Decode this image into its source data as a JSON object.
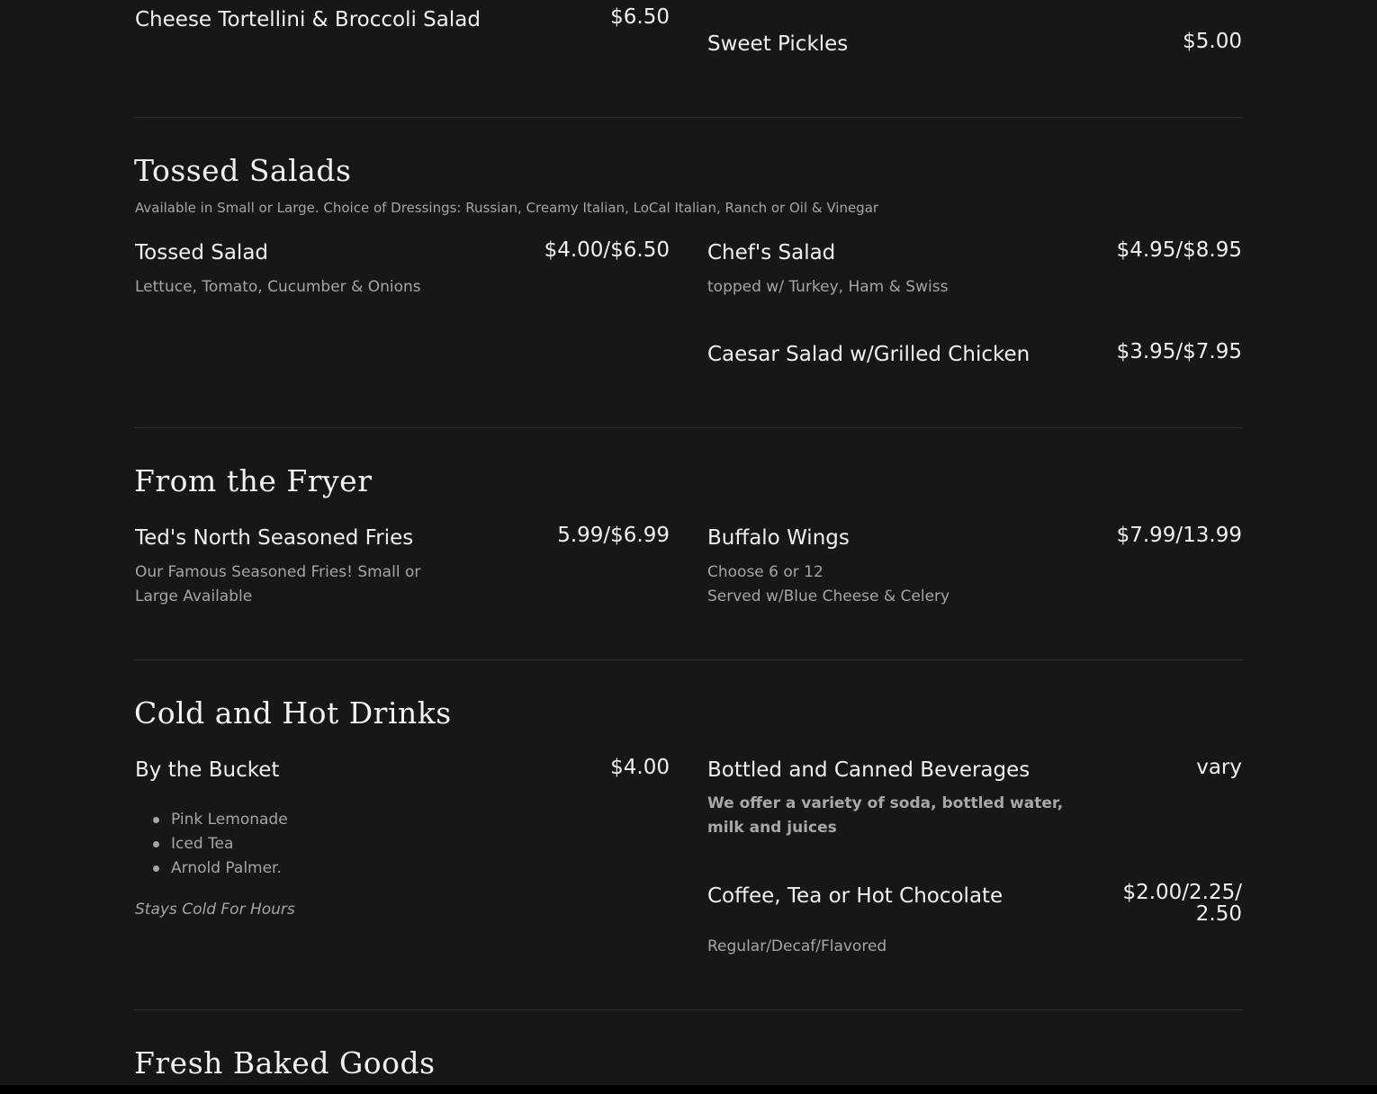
{
  "top_items": {
    "left": {
      "name": "Cheese Tortellini & Broccoli Salad",
      "price": "$6.50"
    },
    "right": {
      "name": "Sweet Pickles",
      "price": "$5.00"
    }
  },
  "tossed_salads": {
    "title": "Tossed Salads",
    "note": "Available in Small or Large. Choice of Dressings: Russian, Creamy Italian, LoCal Italian, Ranch or Oil & Vinegar",
    "items": [
      {
        "name": "Tossed Salad",
        "price": "$4.00/$6.50",
        "desc": "Lettuce, Tomato, Cucumber & Onions"
      },
      {
        "name": "Chef's Salad",
        "price": "$4.95/$8.95",
        "desc": "topped w/ Turkey, Ham & Swiss"
      },
      {
        "name": "Caesar Salad w/Grilled Chicken",
        "price": "$3.95/$7.95"
      }
    ]
  },
  "fryer": {
    "title": "From the Fryer",
    "items": [
      {
        "name": "Ted's North Seasoned Fries",
        "price": "5.99/$6.99",
        "desc_line1": "Our Famous Seasoned Fries! Small or",
        "desc_line2": "Large Available"
      },
      {
        "name": "Buffalo Wings",
        "price": "$7.99/13.99",
        "desc_line1": "Choose 6 or 12",
        "desc_line2": "Served w/Blue Cheese & Celery"
      }
    ]
  },
  "drinks": {
    "title": "Cold and Hot Drinks",
    "bucket": {
      "name": "By the Bucket",
      "price": "$4.00",
      "options": [
        "Pink Lemonade",
        "Iced Tea",
        "Arnold Palmer."
      ],
      "note": "Stays Cold For Hours"
    },
    "bottled": {
      "name": "Bottled and Canned Beverages",
      "price": "vary",
      "desc_line1": "We offer a variety of soda, bottled water,",
      "desc_line2": "milk and juices"
    },
    "coffee": {
      "name": "Coffee, Tea or Hot Chocolate",
      "price_line1": "$2.00/2.25/",
      "price_line2": "2.50",
      "desc": "Regular/Decaf/Flavored"
    }
  },
  "baked": {
    "title": "Fresh Baked Goods"
  }
}
